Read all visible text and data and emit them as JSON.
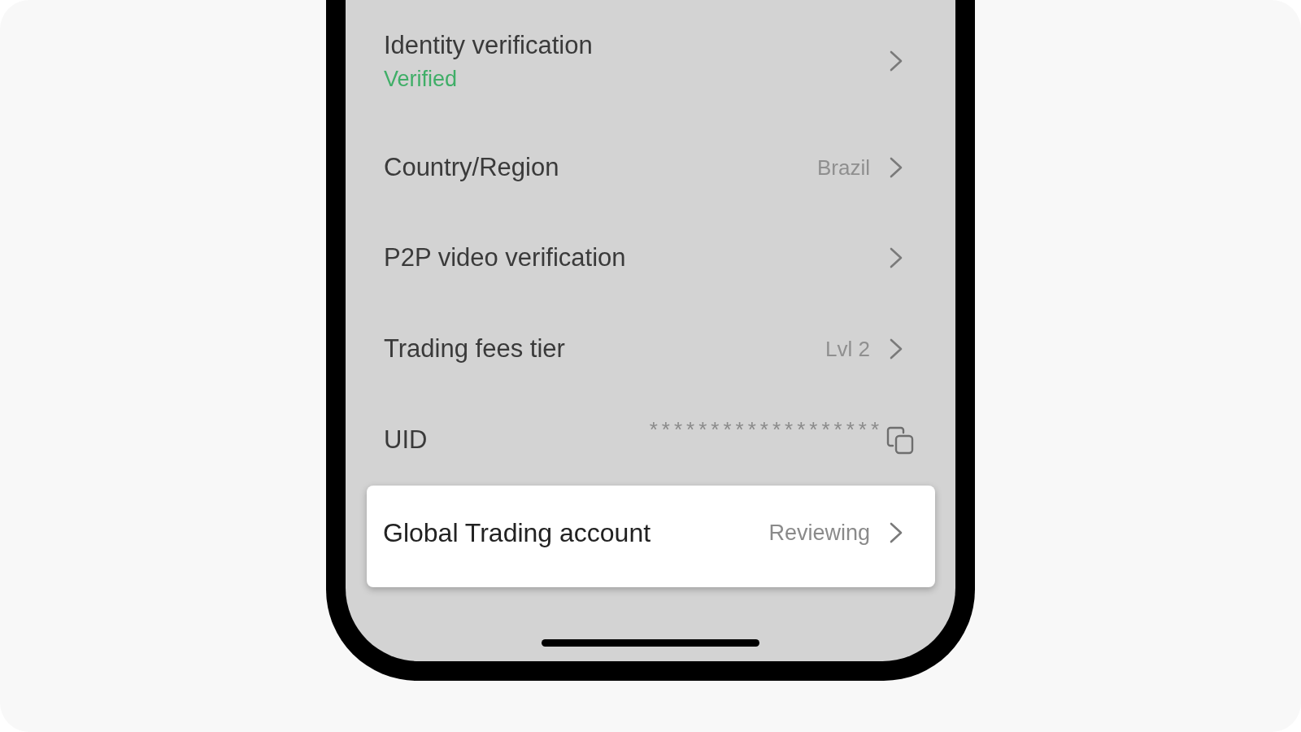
{
  "settings": {
    "items": [
      {
        "kind": "nav",
        "label": "Identity verification",
        "status": "Verified"
      },
      {
        "kind": "nav",
        "label": "Country/Region",
        "value": "Brazil"
      },
      {
        "kind": "nav",
        "label": "P2P video verification"
      },
      {
        "kind": "nav",
        "label": "Trading fees tier",
        "value": "Lvl 2"
      },
      {
        "kind": "copy",
        "label": "UID",
        "value": "*******************"
      }
    ]
  },
  "highlighted_item": {
    "label": "Global Trading account",
    "value": "Reviewing"
  }
}
